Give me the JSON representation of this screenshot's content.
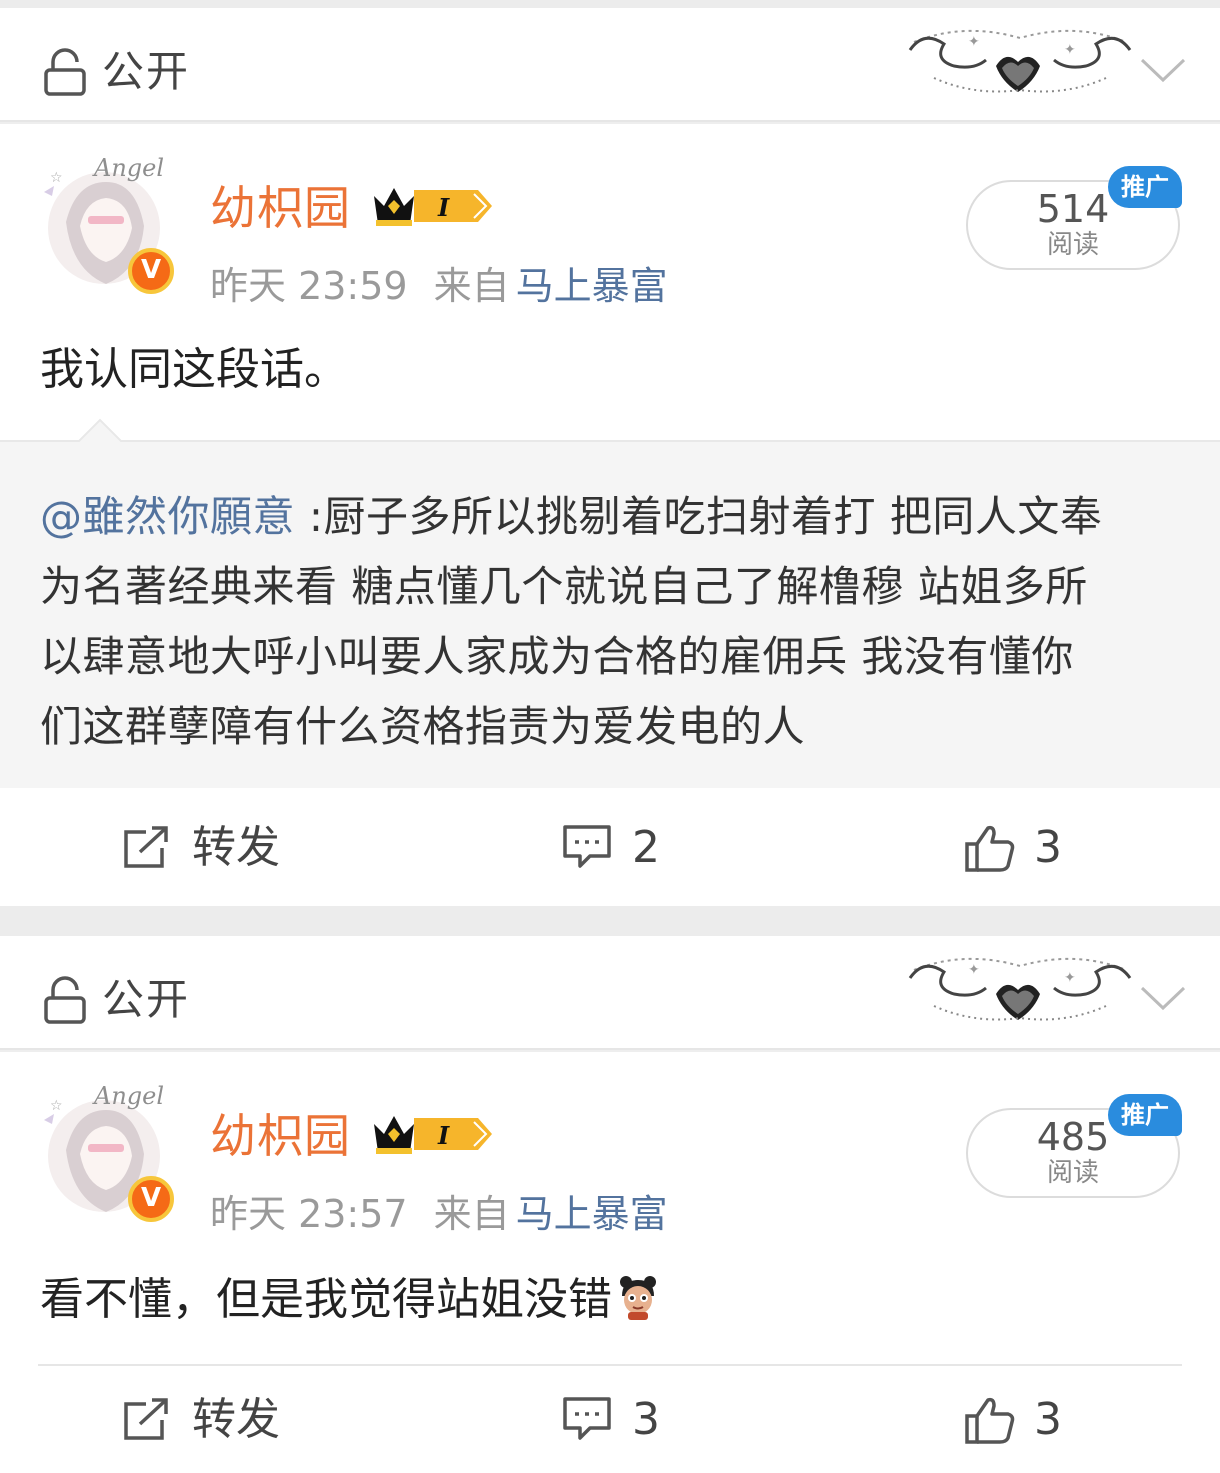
{
  "posts": [
    {
      "privacy_label": "公开",
      "username": "幼枳园",
      "vip_level": "I",
      "time": "昨天 23:59",
      "from_label": "来自",
      "source": "马上暴富",
      "read_count": "514",
      "read_label": "阅读",
      "promo_tag": "推广",
      "text": "我认同这段话。",
      "quote": {
        "mention": "@雖然你願意",
        "lines": [
          " :厨子多所以挑剔着吃扫射着打 把同人文奉",
          "为名著经典来看 糖点懂几个就说自己了解橹穆 站姐多所",
          "以肆意地大呼小叫要人家成为合格的雇佣兵 我没有懂你",
          "们这群孽障有什么资格指责为爱发电的人"
        ]
      },
      "actions": {
        "repost_label": "转发",
        "comment_count": "2",
        "like_count": "3"
      }
    },
    {
      "privacy_label": "公开",
      "username": "幼枳园",
      "vip_level": "I",
      "time": "昨天 23:57",
      "from_label": "来自",
      "source": "马上暴富",
      "read_count": "485",
      "read_label": "阅读",
      "promo_tag": "推广",
      "text": "看不懂，但是我觉得站姐没错",
      "actions": {
        "repost_label": "转发",
        "comment_count": "3",
        "like_count": "3"
      }
    }
  ],
  "avatar_text": "Angel",
  "verified_mark": "V",
  "icons": [
    "lock-icon",
    "chevron-down-icon",
    "heart-ornament-icon",
    "crown-vip-icon",
    "repost-icon",
    "comment-icon",
    "like-icon",
    "emoji-kid-icon"
  ],
  "colors": {
    "username": "#eb7337",
    "link": "#53739e",
    "promo": "#2a8cde",
    "verified": "#f56a16"
  }
}
